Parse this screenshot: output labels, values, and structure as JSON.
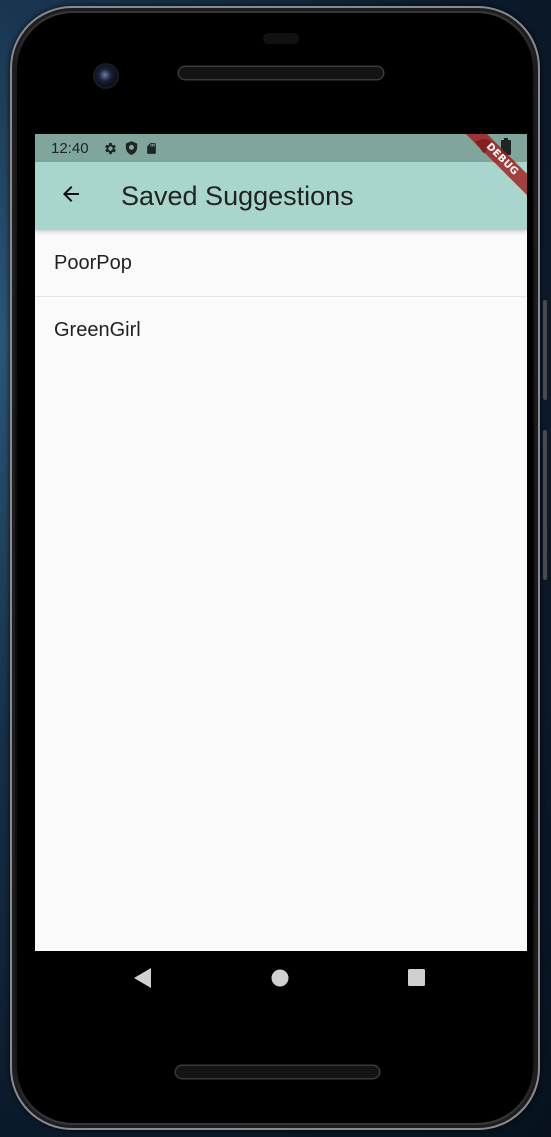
{
  "status_bar": {
    "time": "12:40",
    "left_icons": [
      "gear-icon",
      "shield-icon",
      "sd-card-icon"
    ],
    "right_icons": [
      "wifi-icon",
      "battery-icon"
    ]
  },
  "debug_banner": {
    "label": "DEBUG",
    "color": "#a01e1e"
  },
  "app_bar": {
    "title": "Saved Suggestions",
    "back_icon": "arrow-back-icon",
    "color": "#a9d6cc"
  },
  "saved_list": {
    "items": [
      {
        "label": "PoorPop"
      },
      {
        "label": "GreenGirl"
      }
    ]
  },
  "nav_bar": {
    "buttons": [
      "back-triangle-icon",
      "home-circle-icon",
      "recents-square-icon"
    ]
  }
}
